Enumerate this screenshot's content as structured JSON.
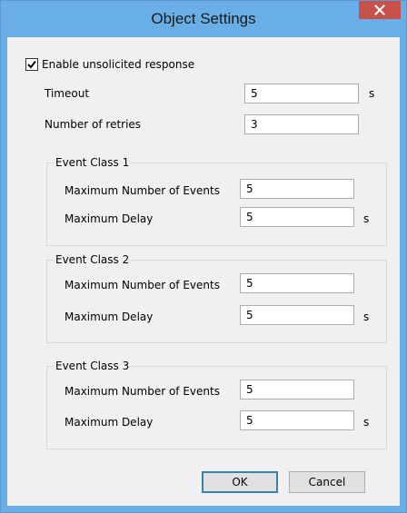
{
  "window": {
    "title": "Object Settings",
    "close_glyph": "close-icon"
  },
  "unsolicited": {
    "checked": true,
    "label": "Enable unsolicited response",
    "timeout_label": "Timeout",
    "timeout_value": "5",
    "timeout_unit": "s",
    "retries_label": "Number of retries",
    "retries_value": "3"
  },
  "event_classes": [
    {
      "title": "Event Class 1",
      "max_events_label": "Maximum Number of Events",
      "max_events_value": "5",
      "max_delay_label": "Maximum Delay",
      "max_delay_value": "5",
      "max_delay_unit": "s"
    },
    {
      "title": "Event Class 2",
      "max_events_label": "Maximum Number of Events",
      "max_events_value": "5",
      "max_delay_label": "Maximum Delay",
      "max_delay_value": "5",
      "max_delay_unit": "s"
    },
    {
      "title": "Event Class 3",
      "max_events_label": "Maximum Number of Events",
      "max_events_value": "5",
      "max_delay_label": "Maximum Delay",
      "max_delay_value": "5",
      "max_delay_unit": "s"
    }
  ],
  "buttons": {
    "ok": "OK",
    "cancel": "Cancel"
  },
  "colors": {
    "titlebar": "#6aaee8",
    "close": "#c7504a",
    "client": "#f0f0f0"
  }
}
